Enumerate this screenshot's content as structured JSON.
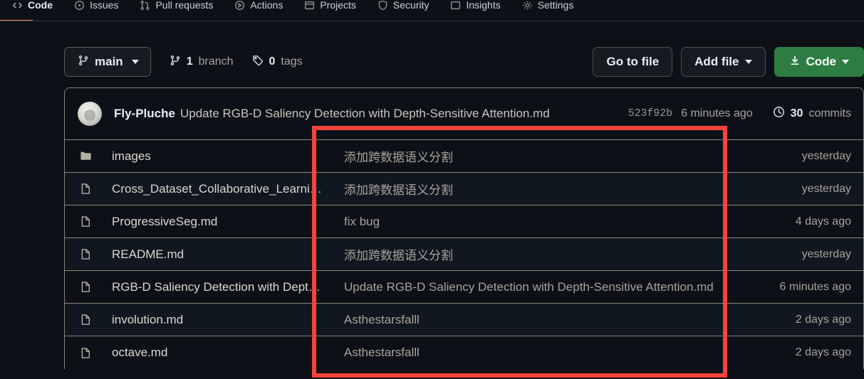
{
  "nav": {
    "tabs": [
      {
        "label": "Code",
        "icon": "code-icon",
        "selected": true
      },
      {
        "label": "Issues",
        "icon": "issue-opened-icon",
        "selected": false
      },
      {
        "label": "Pull requests",
        "icon": "git-pull-request-icon",
        "selected": false
      },
      {
        "label": "Actions",
        "icon": "play-icon",
        "selected": false
      },
      {
        "label": "Projects",
        "icon": "table-icon",
        "selected": false
      },
      {
        "label": "Security",
        "icon": "shield-icon",
        "selected": false
      },
      {
        "label": "Insights",
        "icon": "graph-icon",
        "selected": false
      },
      {
        "label": "Settings",
        "icon": "gear-icon",
        "selected": false
      }
    ]
  },
  "toolbar": {
    "branch": "main",
    "branch_count": "1",
    "branch_label": "branch",
    "tag_count": "0",
    "tag_label": "tags",
    "go_to_file": "Go to file",
    "add_file": "Add file",
    "code": "Code"
  },
  "commit_header": {
    "author": "Fly-Pluche",
    "message": "Update RGB-D Saliency Detection with Depth-Sensitive Attention.md",
    "sha": "523f92b",
    "time": "6 minutes ago",
    "commits_count": "30",
    "commits_label": "commits"
  },
  "files": [
    {
      "name": "images",
      "type": "folder",
      "icon": "folder-icon",
      "commit": "添加跨数据语义分割",
      "time": "yesterday"
    },
    {
      "name": "Cross_Dataset_Collaborative_Learning…",
      "type": "file",
      "icon": "file-icon",
      "commit": "添加跨数据语义分割",
      "time": "yesterday"
    },
    {
      "name": "ProgressiveSeg.md",
      "type": "file",
      "icon": "file-icon",
      "commit": "fix bug",
      "time": "4 days ago"
    },
    {
      "name": "README.md",
      "type": "file",
      "icon": "file-icon",
      "commit": "添加跨数据语义分割",
      "time": "yesterday"
    },
    {
      "name": "RGB-D Saliency Detection with Depth…",
      "type": "file",
      "icon": "file-icon",
      "commit": "Update RGB-D Saliency Detection with Depth-Sensitive Attention.md",
      "time": "6 minutes ago"
    },
    {
      "name": "involution.md",
      "type": "file",
      "icon": "file-icon",
      "commit": "Asthestarsfalll",
      "time": "2 days ago"
    },
    {
      "name": "octave.md",
      "type": "file",
      "icon": "file-icon",
      "commit": "Asthestarsfalll",
      "time": "2 days ago"
    }
  ],
  "annotation": {
    "shape": "rectangle",
    "color": "#f8423c"
  },
  "colors": {
    "page_background": "#0d1117",
    "accent_green": "#2d7d43",
    "selected_tab_underline": "#f78166",
    "annotation_red": "#f8423c",
    "row_border": "#8a8578"
  }
}
